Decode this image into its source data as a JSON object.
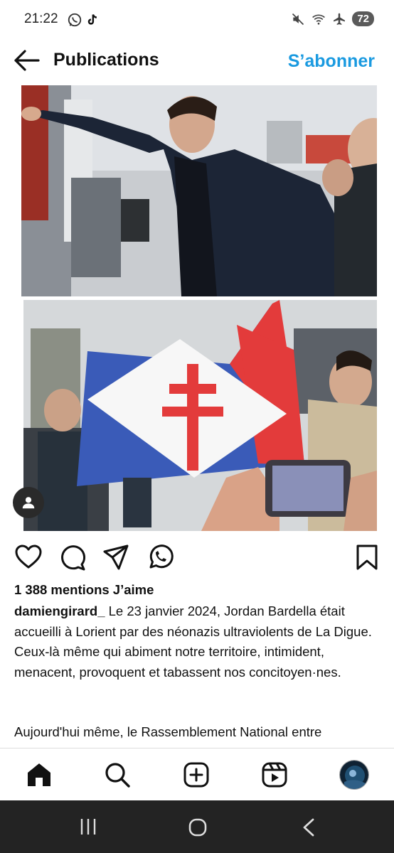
{
  "status_bar": {
    "time": "21:22",
    "left_icons": [
      "whatsapp-icon",
      "tiktok-icon"
    ],
    "right_icons": [
      "mute-icon",
      "wifi-icon",
      "airplane-icon"
    ],
    "battery": "72"
  },
  "header": {
    "back_icon": "arrow-left-icon",
    "title": "Publications",
    "subscribe_label": "S’abonner"
  },
  "post": {
    "photos": [
      "man-in-navy-coat-reaching-out-crowd-photo",
      "group-holding-flag-with-cross-of-lorraine-photo"
    ],
    "actions": [
      "heart-icon",
      "comment-icon",
      "share-icon",
      "whatsapp-icon",
      "bookmark-icon"
    ],
    "likes": "1 388 mentions J’aime",
    "username": "damiengirard_",
    "caption": "Le 23 janvier 2024, Jordan Bardella était accueilli à Lorient par des néonazis ultraviolents de La Digue. Ceux-là même qui abiment notre territoire, intimident, menacent, provoquent et tabassent nos concitoyen·nes.",
    "caption_continued": "Aujourd'hui même, le Rassemblement National entre"
  },
  "bottom_nav": [
    "home-icon",
    "search-icon",
    "create-icon",
    "reels-icon",
    "profile-avatar"
  ],
  "colors": {
    "accent": "#1a9ae0",
    "system_nav_bg": "#232323",
    "flag_blue": "#3a5bb8",
    "flag_red": "#e33b3b"
  }
}
